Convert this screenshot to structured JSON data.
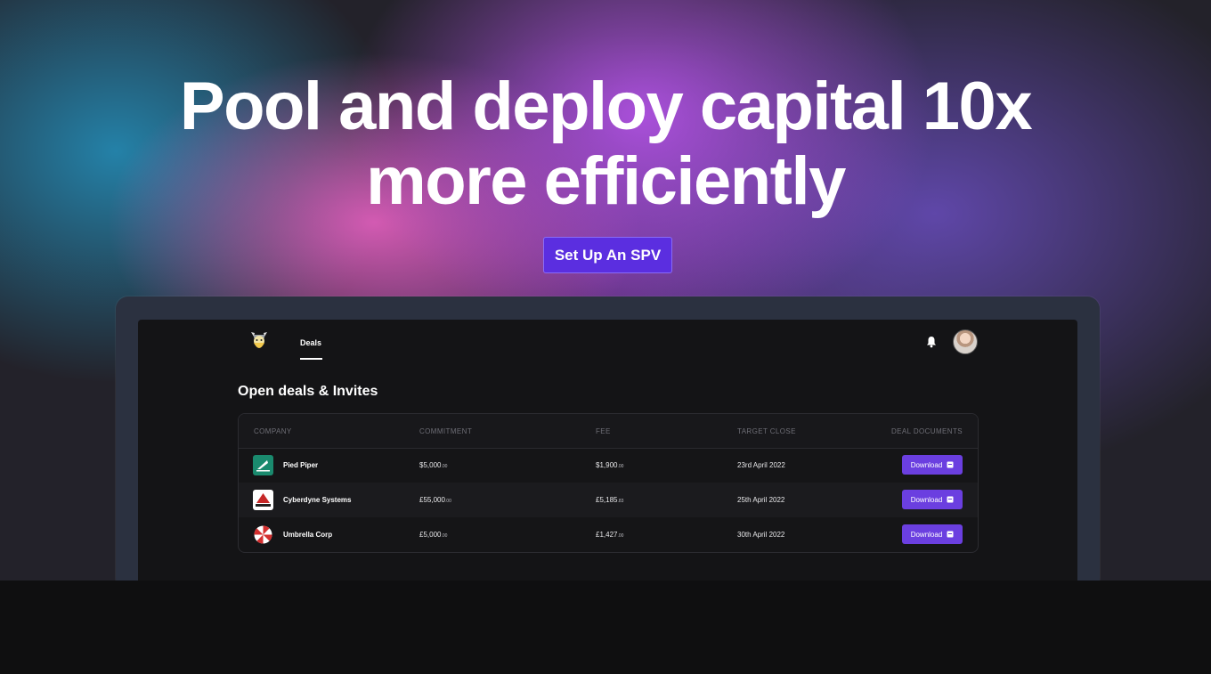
{
  "hero": {
    "title_line1": "Pool and deploy capital 10x",
    "title_line2": "more efficiently",
    "cta_label": "Set Up An SPV"
  },
  "app": {
    "nav": {
      "deals_label": "Deals"
    },
    "section_title": "Open deals & Invites",
    "table": {
      "headers": [
        "COMPANY",
        "COMMITMENT",
        "FEE",
        "TARGET CLOSE",
        "DEAL DOCUMENTS"
      ],
      "rows": [
        {
          "company": "Pied Piper",
          "commitment": "$5,000",
          "commitment_dec": ".00",
          "fee": "$1,900",
          "fee_dec": ".00",
          "target_close": "23rd April 2022",
          "action": "Download"
        },
        {
          "company": "Cyberdyne Systems",
          "commitment": "£55,000",
          "commitment_dec": ".00",
          "fee": "£5,185",
          "fee_dec": ".83",
          "target_close": "25th April 2022",
          "action": "Download"
        },
        {
          "company": "Umbrella Corp",
          "commitment": "£5,000",
          "commitment_dec": ".00",
          "fee": "£1,427",
          "fee_dec": ".00",
          "target_close": "30th April 2022",
          "action": "Download"
        }
      ]
    }
  },
  "colors": {
    "accent": "#6b3fe0",
    "cta": "#5b2ee0",
    "screen_bg": "#141416"
  }
}
